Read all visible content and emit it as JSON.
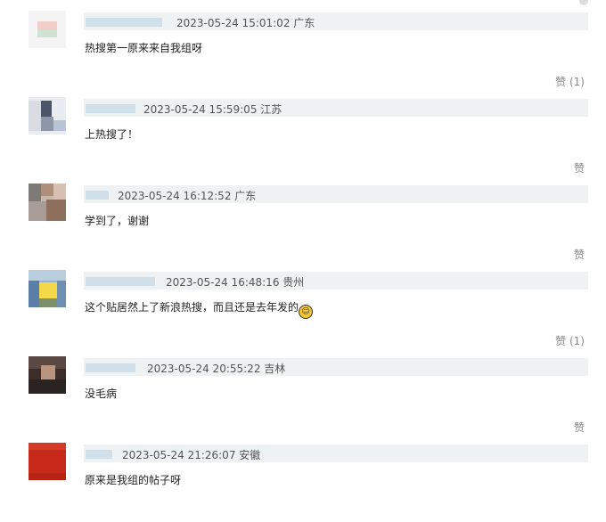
{
  "comments": [
    {
      "time_loc": "2023-05-24 15:01:02 广东",
      "text": "热搜第一原来来自我组呀",
      "like": "赞 (1)"
    },
    {
      "time_loc": "2023-05-24 15:59:05 江苏",
      "text": "上热搜了！",
      "like": "赞"
    },
    {
      "time_loc": "2023-05-24 16:12:52 广东",
      "text": "学到了，谢谢",
      "like": "赞"
    },
    {
      "time_loc": "2023-05-24 16:48:16 贵州",
      "text": "这个贴居然上了新浪热搜，而且还是去年发的",
      "like": "赞 (1)",
      "emoji": "smiling-face-icon"
    },
    {
      "time_loc": "2023-05-24 20:55:22 吉林",
      "text": "没毛病",
      "like": "赞"
    },
    {
      "time_loc": "2023-05-24 21:26:07 安徽",
      "text": "原来是我组的帖子呀",
      "like": ""
    }
  ],
  "colors": {
    "meta_bar_bg": "#eef2f2",
    "name_blur": "#cfe0ea",
    "like_text": "#888888"
  }
}
